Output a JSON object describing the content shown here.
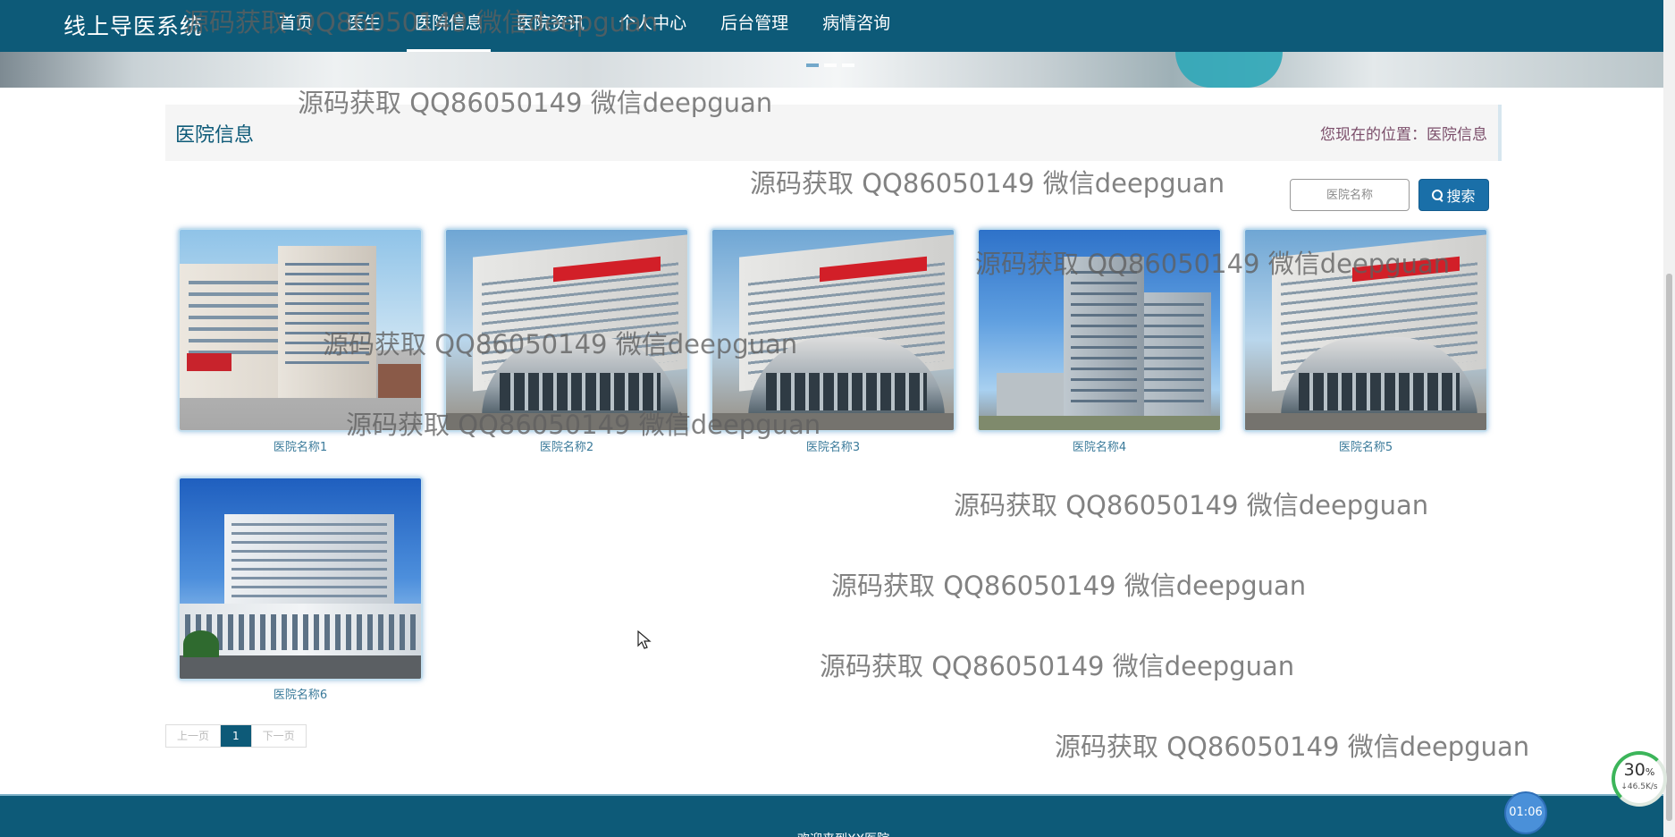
{
  "nav": {
    "brand": "线上导医系统",
    "items": [
      {
        "label": "首页"
      },
      {
        "label": "医生"
      },
      {
        "label": "医院信息"
      },
      {
        "label": "医院资讯"
      },
      {
        "label": "个人中心"
      },
      {
        "label": "后台管理"
      },
      {
        "label": "病情咨询"
      }
    ],
    "active_index": 2
  },
  "breadcrumb": {
    "title": "医院信息",
    "location_prefix": "您现在的位置：",
    "location_current": "医院信息"
  },
  "search": {
    "placeholder": "医院名称",
    "button_label": "搜索",
    "button_icon": "search-icon"
  },
  "hospitals": [
    {
      "name": "医院名称1"
    },
    {
      "name": "医院名称2"
    },
    {
      "name": "医院名称3"
    },
    {
      "name": "医院名称4"
    },
    {
      "name": "医院名称5"
    },
    {
      "name": "医院名称6"
    }
  ],
  "pagination": {
    "prev_label": "上一页",
    "current_page": "1",
    "next_label": "下一页"
  },
  "footer": {
    "text": "欢迎来到XX医院"
  },
  "watermark": "源码获取 QQ86050149 微信deepguan",
  "widgets": {
    "net_percent": "30",
    "net_percent_unit": "%",
    "net_speed": "↓46.5K/s",
    "timer": "01:06"
  },
  "colors": {
    "nav_bg": "#0d5a78",
    "accent": "#1a6fa8",
    "label": "#3a7a9a"
  }
}
